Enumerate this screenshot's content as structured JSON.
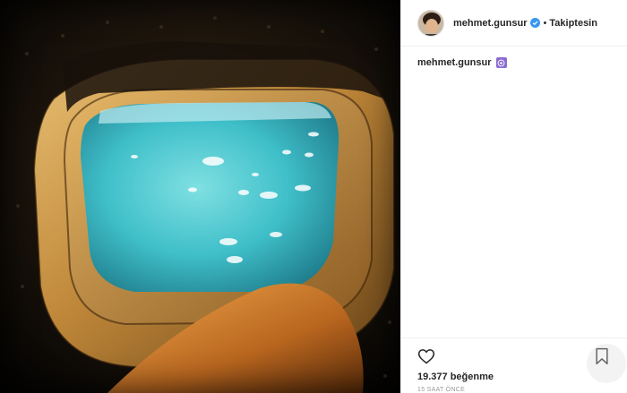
{
  "post": {
    "photo_alt": "airplane-window-photo",
    "header": {
      "username": "mehmet.gunsur",
      "verified_icon": "verified-badge-icon",
      "separator": "•",
      "follow_label": "Takiptesin"
    },
    "caption": {
      "username": "mehmet.gunsur",
      "emoji_icon": "purple-emoji-icon"
    },
    "actions": {
      "like_icon": "heart-icon",
      "save_icon": "bookmark-icon",
      "likes_text": "19.377 beğenme",
      "time_text": "15 SAAT ÖNCE"
    }
  },
  "colors": {
    "verified_blue": "#3897f0",
    "emoji_purple": "#8a6bd1",
    "text_primary": "#262626",
    "text_muted": "#999999",
    "border": "#efefef"
  }
}
